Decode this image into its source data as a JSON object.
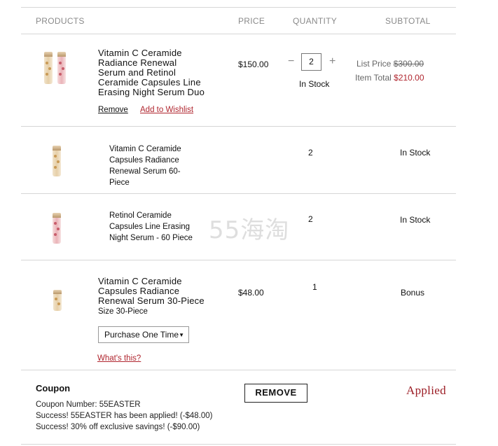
{
  "headers": {
    "products": "PRODUCTS",
    "price": "PRICE",
    "quantity": "QUANTITY",
    "subtotal": "SUBTOTAL"
  },
  "item1": {
    "name_lines": [
      "Vitamin C Ceramide",
      "Radiance Renewal",
      "Serum and Retinol",
      "Ceramide Capsules Line",
      "Erasing Night Serum Duo"
    ],
    "price": "$150.00",
    "quantity": "2",
    "stock": "In Stock",
    "remove": "Remove",
    "wishlist": "Add to Wishlist",
    "list_price_label": "List Price",
    "list_price": "$300.00",
    "item_total_label": "Item Total",
    "item_total": "$210.00",
    "minus": "−",
    "plus": "+"
  },
  "sub1": {
    "name_lines": [
      "Vitamin C Ceramide",
      "Capsules Radiance",
      "Renewal Serum 60-",
      "Piece"
    ],
    "quantity": "2",
    "stock": "In Stock"
  },
  "sub2": {
    "name_lines": [
      "Retinol Ceramide",
      "Capsules Line Erasing",
      "Night Serum - 60 Piece"
    ],
    "quantity": "2",
    "stock": "In Stock"
  },
  "item2": {
    "name_lines": [
      "Vitamin C Ceramide",
      "Capsules Radiance",
      "Renewal Serum 30-Piece"
    ],
    "size": "Size 30-Piece",
    "price": "$48.00",
    "quantity": "1",
    "status": "Bonus",
    "purchase_option": "Purchase One Time",
    "whats_this": "What's this?"
  },
  "coupon": {
    "title": "Coupon",
    "number_line": "Coupon Number: 55EASTER",
    "success1": "Success! 55EASTER has been applied! (-$48.00)",
    "success2": "Success! 30% off exclusive savings! (-$90.00)",
    "remove_button": "REMOVE",
    "status": "Applied"
  },
  "watermark": "55海淘",
  "colors": {
    "accent_red": "#b0262f",
    "applied_red": "#9b1c24",
    "divider": "#d6d6d6"
  }
}
